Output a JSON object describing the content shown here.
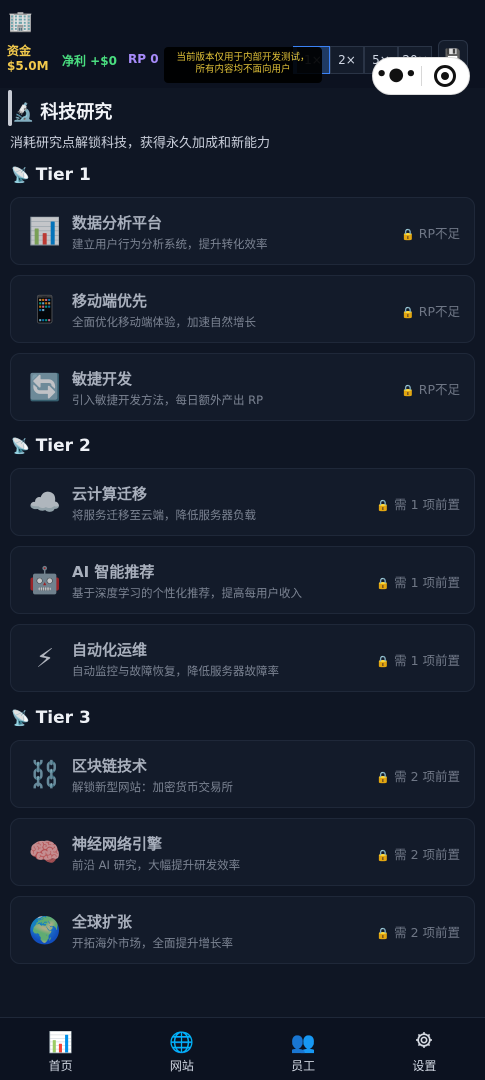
{
  "header": {
    "logo_icon": "🏢",
    "funds_label": "资金",
    "funds_value": "$5.0M",
    "profit": "净利 +$0",
    "rp": "RP 0",
    "speeds": [
      "1×",
      "2×",
      "5×",
      "20×"
    ],
    "active_speed": "1×",
    "save_icon": "💾",
    "notice_line1": "当前版本仅用于内部开发测试，",
    "notice_line2": "所有内容均不面向用户",
    "capsule_more": "•●•"
  },
  "page": {
    "title_icon": "🔬",
    "title": "科技研究",
    "desc": "消耗研究点解锁科技，获得永久加成和新能力"
  },
  "tiers": [
    {
      "icon": "📡",
      "label": "Tier 1",
      "items": [
        {
          "icon": "📊",
          "name": "数据分析平台",
          "desc": "建立用户行为分析系统，提升转化效率",
          "status": "RP不足"
        },
        {
          "icon": "📱",
          "name": "移动端优先",
          "desc": "全面优化移动端体验，加速自然增长",
          "status": "RP不足"
        },
        {
          "icon": "🔄",
          "name": "敏捷开发",
          "desc": "引入敏捷开发方法，每日额外产出 RP",
          "status": "RP不足"
        }
      ]
    },
    {
      "icon": "📡",
      "label": "Tier 2",
      "items": [
        {
          "icon": "☁️",
          "name": "云计算迁移",
          "desc": "将服务迁移至云端，降低服务器负载",
          "status": "需 1 项前置"
        },
        {
          "icon": "🤖",
          "name": "AI 智能推荐",
          "desc": "基于深度学习的个性化推荐，提高每用户收入",
          "status": "需 1 项前置"
        },
        {
          "icon": "⚡",
          "name": "自动化运维",
          "desc": "自动监控与故障恢复，降低服务器故障率",
          "status": "需 1 项前置"
        }
      ]
    },
    {
      "icon": "📡",
      "label": "Tier 3",
      "items": [
        {
          "icon": "⛓️",
          "name": "区块链技术",
          "desc": "解锁新型网站：加密货币交易所",
          "status": "需 2 项前置"
        },
        {
          "icon": "🧠",
          "name": "神经网络引擎",
          "desc": "前沿 AI 研究，大幅提升研发效率",
          "status": "需 2 项前置"
        },
        {
          "icon": "🌍",
          "name": "全球扩张",
          "desc": "开拓海外市场，全面提升增长率",
          "status": "需 2 项前置"
        }
      ]
    }
  ],
  "lock_icon": "🔒",
  "nav": [
    {
      "icon": "📊",
      "label": "首页"
    },
    {
      "icon": "🌐",
      "label": "网站"
    },
    {
      "icon": "👥",
      "label": "员工"
    },
    {
      "icon": "gear-icon",
      "label": "设置"
    }
  ]
}
